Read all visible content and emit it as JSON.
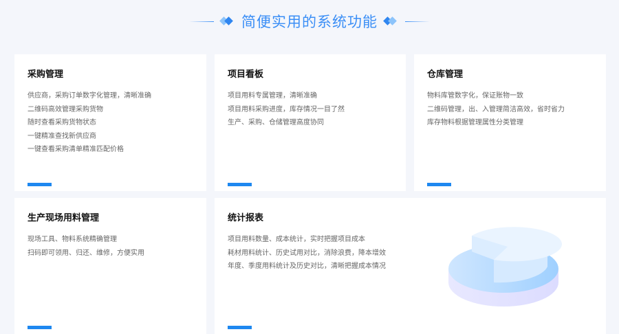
{
  "header": {
    "title": "简便实用的系统功能"
  },
  "cards": [
    {
      "title": "采购管理",
      "lines": [
        "供应商，采购订单数字化管理，清晰准确",
        "二维码高效管理采购货物",
        "随时查看采购货物状态",
        "一键精准查找新供应商",
        "一键查看采购清单精准匹配价格"
      ]
    },
    {
      "title": "项目看板",
      "lines": [
        "项目用料专属管理，清晰准确",
        "项目用料采购进度，库存情况一目了然",
        "生产、采购、仓储管理高度协同"
      ]
    },
    {
      "title": "仓库管理",
      "lines": [
        "物料库管数字化，保证账物一致",
        "二维码管理，出、入管理简洁高效，省时省力",
        "库存物料根据管理属性分类管理"
      ]
    },
    {
      "title": "生产现场用料管理",
      "lines": [
        "现场工具、物料系统精确管理",
        "扫码即可领用、归还、维修，方便实用"
      ]
    },
    {
      "title": "统计报表",
      "lines": [
        "项目用料数量、成本统计，实时把握项目成本",
        "耗材用料统计、历史试用对比，消除浪费，降本增效",
        "年度、季度用料统计及历史对比，清晰把握成本情况"
      ]
    }
  ],
  "colors": {
    "accent": "#1e88f0",
    "title": "#3a8ef6",
    "background": "#f4f6fb"
  }
}
